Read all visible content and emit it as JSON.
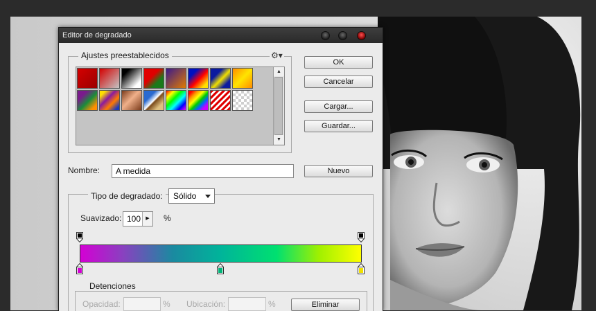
{
  "dialog": {
    "title": "Editor de degradado"
  },
  "presets": {
    "label": "Ajustes preestablecidos",
    "menu_icon": "gear-icon",
    "swatches": [
      {
        "name": "foreground-to-background",
        "css": "linear-gradient(135deg, #d40000, #9a0000)"
      },
      {
        "name": "foreground-to-transparent",
        "css": "linear-gradient(135deg, #d40000 0%, rgba(212,0,0,0) 100%)"
      },
      {
        "name": "black-white",
        "css": "linear-gradient(135deg, #000 20%, #fff 80%)"
      },
      {
        "name": "red-green",
        "css": "linear-gradient(135deg, #e00000 40%, #1a7a1a 70%)"
      },
      {
        "name": "violet-orange",
        "css": "linear-gradient(135deg, #3a1a8c, #e07a00)"
      },
      {
        "name": "blue-red-yellow",
        "css": "linear-gradient(135deg, #0010c0 25%, #ff0000 55%, #ffe000 85%)"
      },
      {
        "name": "blue-yellow-blue",
        "css": "linear-gradient(135deg, #0a1aa0 30%, #f0e000 55%, #0a1aa0 80%)"
      },
      {
        "name": "orange-yellow-orange",
        "css": "linear-gradient(135deg, #ff8c00, #ffe400 50%, #ff8c00)"
      },
      {
        "name": "violet-green-orange",
        "css": "linear-gradient(135deg, #7a1a8c 25%, #1a8c3a 55%, #ff9000 85%)"
      },
      {
        "name": "yellow-violet-orange-blue",
        "css": "linear-gradient(135deg, #ffe000 15%, #8a1aa0 40%, #ff7a00 65%, #1a3ac0 90%)"
      },
      {
        "name": "copper",
        "css": "linear-gradient(135deg, #7a3a1a, #f0b08a 45%, #7a3a1a)"
      },
      {
        "name": "chrome",
        "css": "linear-gradient(135deg, #2a6ad0 30%, #ffffff 50%, #7a4a1a 55%, #e0c080 80%)"
      },
      {
        "name": "spectrum",
        "css": "linear-gradient(135deg, #ff0000, #ffff00 20%, #00ff00 40%, #00ffff 60%, #0000ff 80%, #ff00ff)"
      },
      {
        "name": "transparent-rainbow",
        "css": "linear-gradient(135deg, #ff0000 10%, #ff9900 25%, #ffff00 40%, #00cc00 55%, #0066ff 70%, #cc00ff 85%)"
      },
      {
        "name": "transparent-stripes",
        "css": "repeating-linear-gradient(135deg, #e00000 0 3px, #ffffff 3px 6px)"
      },
      {
        "name": "transparent",
        "css": "repeating-conic-gradient(#cfcfcf 0 25%, #ffffff 0 50%) 0 0/8px 8px"
      }
    ]
  },
  "buttons": {
    "ok": "OK",
    "cancel": "Cancelar",
    "load": "Cargar...",
    "save": "Guardar...",
    "new": "Nuevo",
    "delete": "Eliminar"
  },
  "name_field": {
    "label": "Nombre:",
    "value": "A medida"
  },
  "gradient_type": {
    "label": "Tipo de degradado:",
    "value": "Sólido"
  },
  "smoothness": {
    "label": "Suavizado:",
    "value": "100",
    "unit": "%"
  },
  "gradient": {
    "css": "linear-gradient(90deg, #d400d4 0%, #8a40c0 15%, #1a8aa0 33%, #00b49a 50%, #00e070 70%, #a0f000 85%, #ffff00 100%)",
    "opacity_stops": [
      {
        "location": 0,
        "color": "#000000"
      },
      {
        "location": 100,
        "color": "#000000"
      }
    ],
    "color_stops": [
      {
        "location": 0,
        "color": "#d400d4"
      },
      {
        "location": 50,
        "color": "#00b478"
      },
      {
        "location": 100,
        "color": "#f0e000"
      }
    ]
  },
  "stops_group": {
    "label": "Detenciones",
    "opacity_label": "Opacidad:",
    "opacity_unit": "%",
    "location_label": "Ubicación:",
    "location_unit": "%"
  }
}
